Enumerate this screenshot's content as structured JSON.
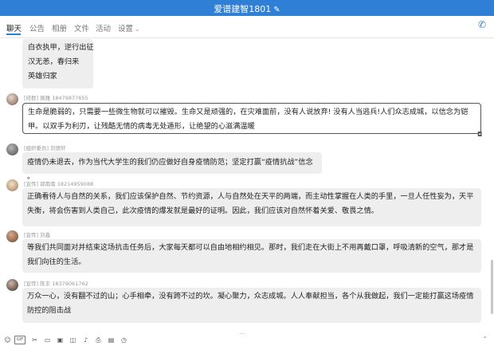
{
  "window": {
    "title": "爱谱建智1801",
    "edit_icon": "pencil-icon"
  },
  "tabs": [
    {
      "label": "聊天",
      "active": true
    },
    {
      "label": "公告"
    },
    {
      "label": "相册"
    },
    {
      "label": "文件"
    },
    {
      "label": "活动"
    },
    {
      "label": "设置",
      "has_dropdown": true
    }
  ],
  "header_actions": {
    "phone_icon": "phone-icon"
  },
  "messages": [
    {
      "lines": [
        "白衣执甲，逆行出征",
        "汉无恙，春归来",
        "英雄归家"
      ]
    },
    {
      "role": "[班群]",
      "name": "佩雅 18479877655",
      "text": "生命是脆弱的，只需要一些微生物就可以摧毁。生命又是顽强的，在灾难面前，没有人说放弃! 没有人当逃兵!人们众志成城，以信念为铠甲。以双手为利刃，让残酷无情的病毒无处遁形，让绝望的心滋满温暖",
      "selected": true
    },
    {
      "role": "[组织委员]",
      "name": "刘德轩",
      "text": "疫情仍未退去，作为当代大学生的我们仍应做好自身疫情防范；坚定打赢“疫情抗战”信念 。"
    },
    {
      "role": "[宣传]",
      "name": "郭南南 18214959088",
      "text": "正确看待人与自然的关系，我们应该保护自然、节约资源，人与自然处在天平的两端，而主动性掌握在人类的手里，一旦人任性妄为，天平失衡，将会伤害到人类自己，此次疫情的爆发就是最好的证明。因此，我们应该对自然怀着关爱、敬畏之情。"
    },
    {
      "role": "[宣传]",
      "name": "刘鑫",
      "text": "等我们共同面对并结束这场抗击任务后，大家每天都可以自由地相约相见。那时，我们走在大街上不用再戴口罩，呼吸清新的空气，那才是我们向往的生活。"
    },
    {
      "role": "[宣传]",
      "name": "陈丰 18379061762",
      "text": "万众一心，没有翻不过的山；心手相牵，没有跨不过的坎。凝心聚力，众志成城。人人奉献担当，各个从我做起，我们一定能打赢这场疫情防控的阻击战"
    }
  ],
  "toolbar": {
    "items": [
      "emoji-icon",
      "gif-icon",
      "cut-icon",
      "folder-icon",
      "image-icon",
      "chat-record-icon",
      "voice-icon",
      "file-icon",
      "note-icon",
      "clock-icon"
    ],
    "gif_label": "GIF",
    "right_icon": "expand-icon"
  }
}
